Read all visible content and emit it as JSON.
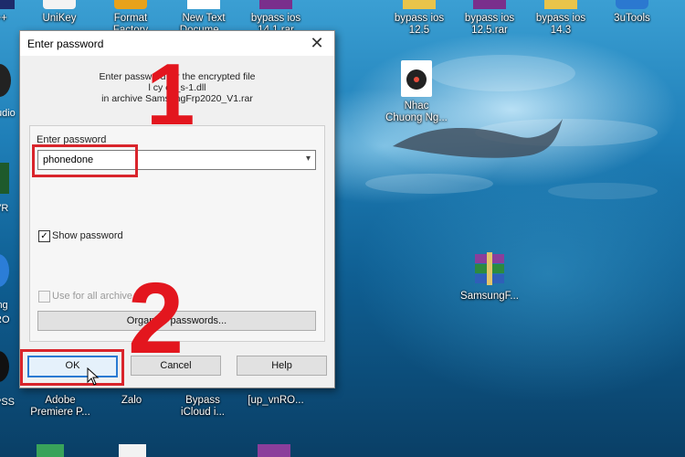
{
  "desktop": {
    "top_icons": [
      {
        "label": "d++"
      },
      {
        "label": "UniKey"
      },
      {
        "label": "Format Factory"
      },
      {
        "label": "New Text Docume..."
      },
      {
        "label": "bypass ios 14.1.rar"
      },
      {
        "label": "bypass ios 12.5"
      },
      {
        "label": "bypass ios 12.5.rar"
      },
      {
        "label": "bypass ios 14.3"
      },
      {
        "label": "3uTools"
      }
    ],
    "left_strip": [
      "udio",
      "VR",
      "ing",
      "RO",
      "PSS"
    ],
    "nhac_icon": {
      "line1": "Nhac",
      "line2": "Chuong Ng..."
    },
    "samsung_icon": {
      "label": "SamsungF..."
    },
    "bottom_icons": [
      {
        "line1": "Adobe",
        "line2": "Premiere P..."
      },
      {
        "line1": "Zalo",
        "line2": ""
      },
      {
        "line1": "Bypass",
        "line2": "iCloud i..."
      },
      {
        "line1": "[up_vnRO...",
        "line2": ""
      }
    ]
  },
  "dialog": {
    "title": "Enter password",
    "close_glyph": "✕",
    "info_line1": "Enter password for the encrypted file",
    "info_line2": "l  cy  cc_s-1.dll",
    "info_line3": "in archive SamsungFrp2020_V1.rar",
    "password_label": "Enter password",
    "password_value": "phonedone",
    "show_password_label": "Show password",
    "show_password_checked": true,
    "use_all_label": "Use for all archive",
    "organize_label": "Organize passwords...",
    "ok_label": "OK",
    "cancel_label": "Cancel",
    "help_label": "Help"
  },
  "annotations": {
    "step1": "1",
    "step2": "2",
    "color": "#e3161e"
  }
}
